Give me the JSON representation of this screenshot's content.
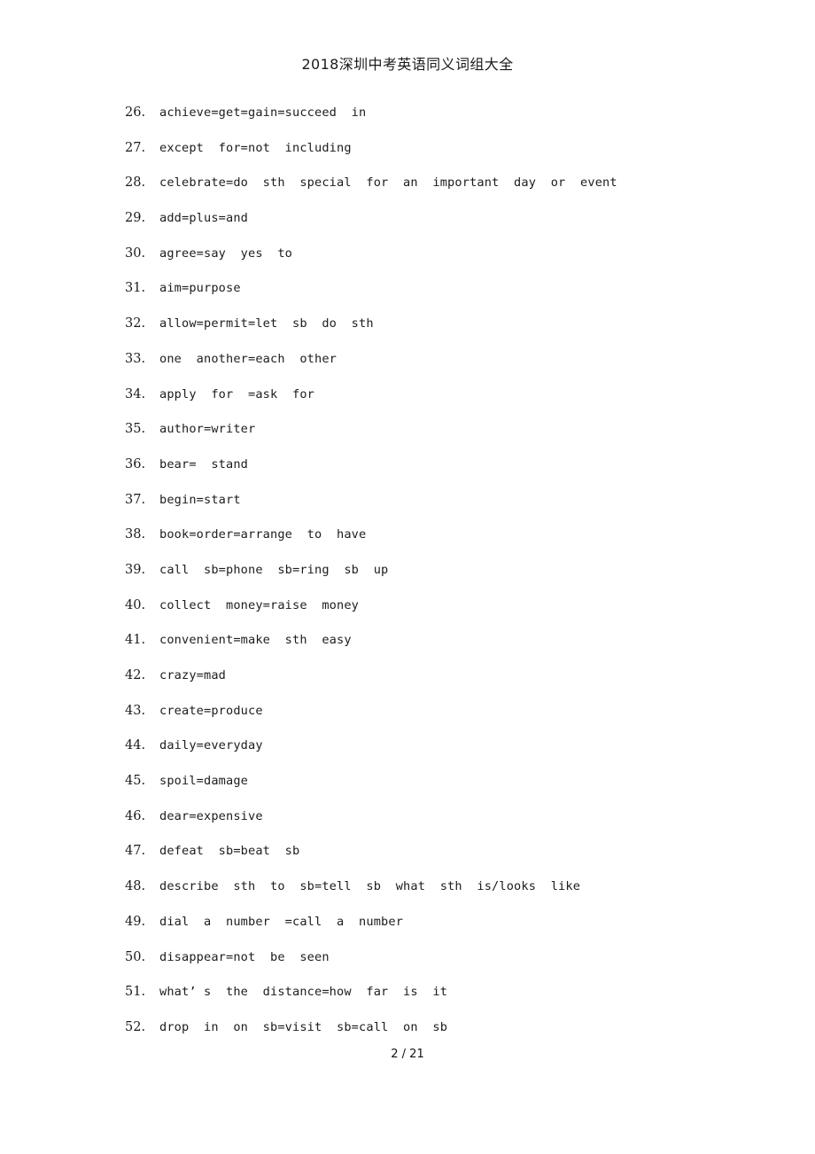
{
  "document": {
    "title": "2018深圳中考英语同义词组大全",
    "footer": "2 / 21",
    "page_number": "2",
    "total_pages": "21"
  },
  "entries": [
    {
      "num": "26.",
      "text": "achieve=get=gain=succeed  in"
    },
    {
      "num": "27.",
      "text": "except  for=not  including"
    },
    {
      "num": "28.",
      "text": "celebrate=do  sth  special  for  an  important  day  or  event"
    },
    {
      "num": "29.",
      "text": "add=plus=and"
    },
    {
      "num": "30.",
      "text": "agree=say  yes  to"
    },
    {
      "num": "31.",
      "text": "aim=purpose"
    },
    {
      "num": "32.",
      "text": "allow=permit=let  sb  do  sth"
    },
    {
      "num": "33.",
      "text": "one  another=each  other"
    },
    {
      "num": "34.",
      "text": "apply  for  =ask  for"
    },
    {
      "num": "35.",
      "text": "author=writer"
    },
    {
      "num": "36.",
      "text": "bear=  stand"
    },
    {
      "num": "37.",
      "text": "begin=start"
    },
    {
      "num": "38.",
      "text": "book=order=arrange  to  have"
    },
    {
      "num": "39.",
      "text": "call  sb=phone  sb=ring  sb  up"
    },
    {
      "num": "40.",
      "text": "collect  money=raise  money"
    },
    {
      "num": "41.",
      "text": "convenient=make  sth  easy"
    },
    {
      "num": "42.",
      "text": "crazy=mad"
    },
    {
      "num": "43.",
      "text": "create=produce"
    },
    {
      "num": "44.",
      "text": "daily=everyday"
    },
    {
      "num": "45.",
      "text": "spoil=damage"
    },
    {
      "num": "46.",
      "text": "dear=expensive"
    },
    {
      "num": "47.",
      "text": "defeat  sb=beat  sb"
    },
    {
      "num": "48.",
      "text": "describe  sth  to  sb=tell  sb  what  sth  is/looks  like"
    },
    {
      "num": "49.",
      "text": "dial  a  number  =call  a  number"
    },
    {
      "num": "50.",
      "text": "disappear=not  be  seen"
    },
    {
      "num": "51.",
      "text": "what’ s  the  distance=how  far  is  it"
    },
    {
      "num": "52.",
      "text": "drop  in  on  sb=visit  sb=call  on  sb"
    }
  ]
}
